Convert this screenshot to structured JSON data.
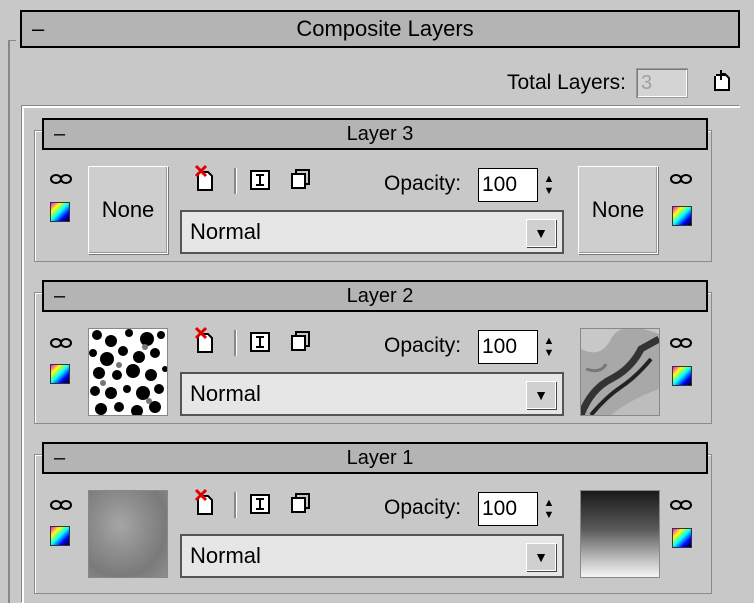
{
  "rollout": {
    "minus": "–",
    "title": "Composite Layers"
  },
  "total": {
    "label": "Total Layers:",
    "value": "3"
  },
  "icons": {
    "link": "∞",
    "new": "🗋",
    "toggle": "🞕",
    "copy": "🗍"
  },
  "layers": [
    {
      "minus": "–",
      "title": "Layer 3",
      "left_map": "None",
      "right_map": "None",
      "opacity_label": "Opacity:",
      "opacity": "100",
      "blend": "Normal"
    },
    {
      "minus": "–",
      "title": "Layer 2",
      "opacity_label": "Opacity:",
      "opacity": "100",
      "blend": "Normal"
    },
    {
      "minus": "–",
      "title": "Layer 1",
      "opacity_label": "Opacity:",
      "opacity": "100",
      "blend": "Normal"
    }
  ]
}
